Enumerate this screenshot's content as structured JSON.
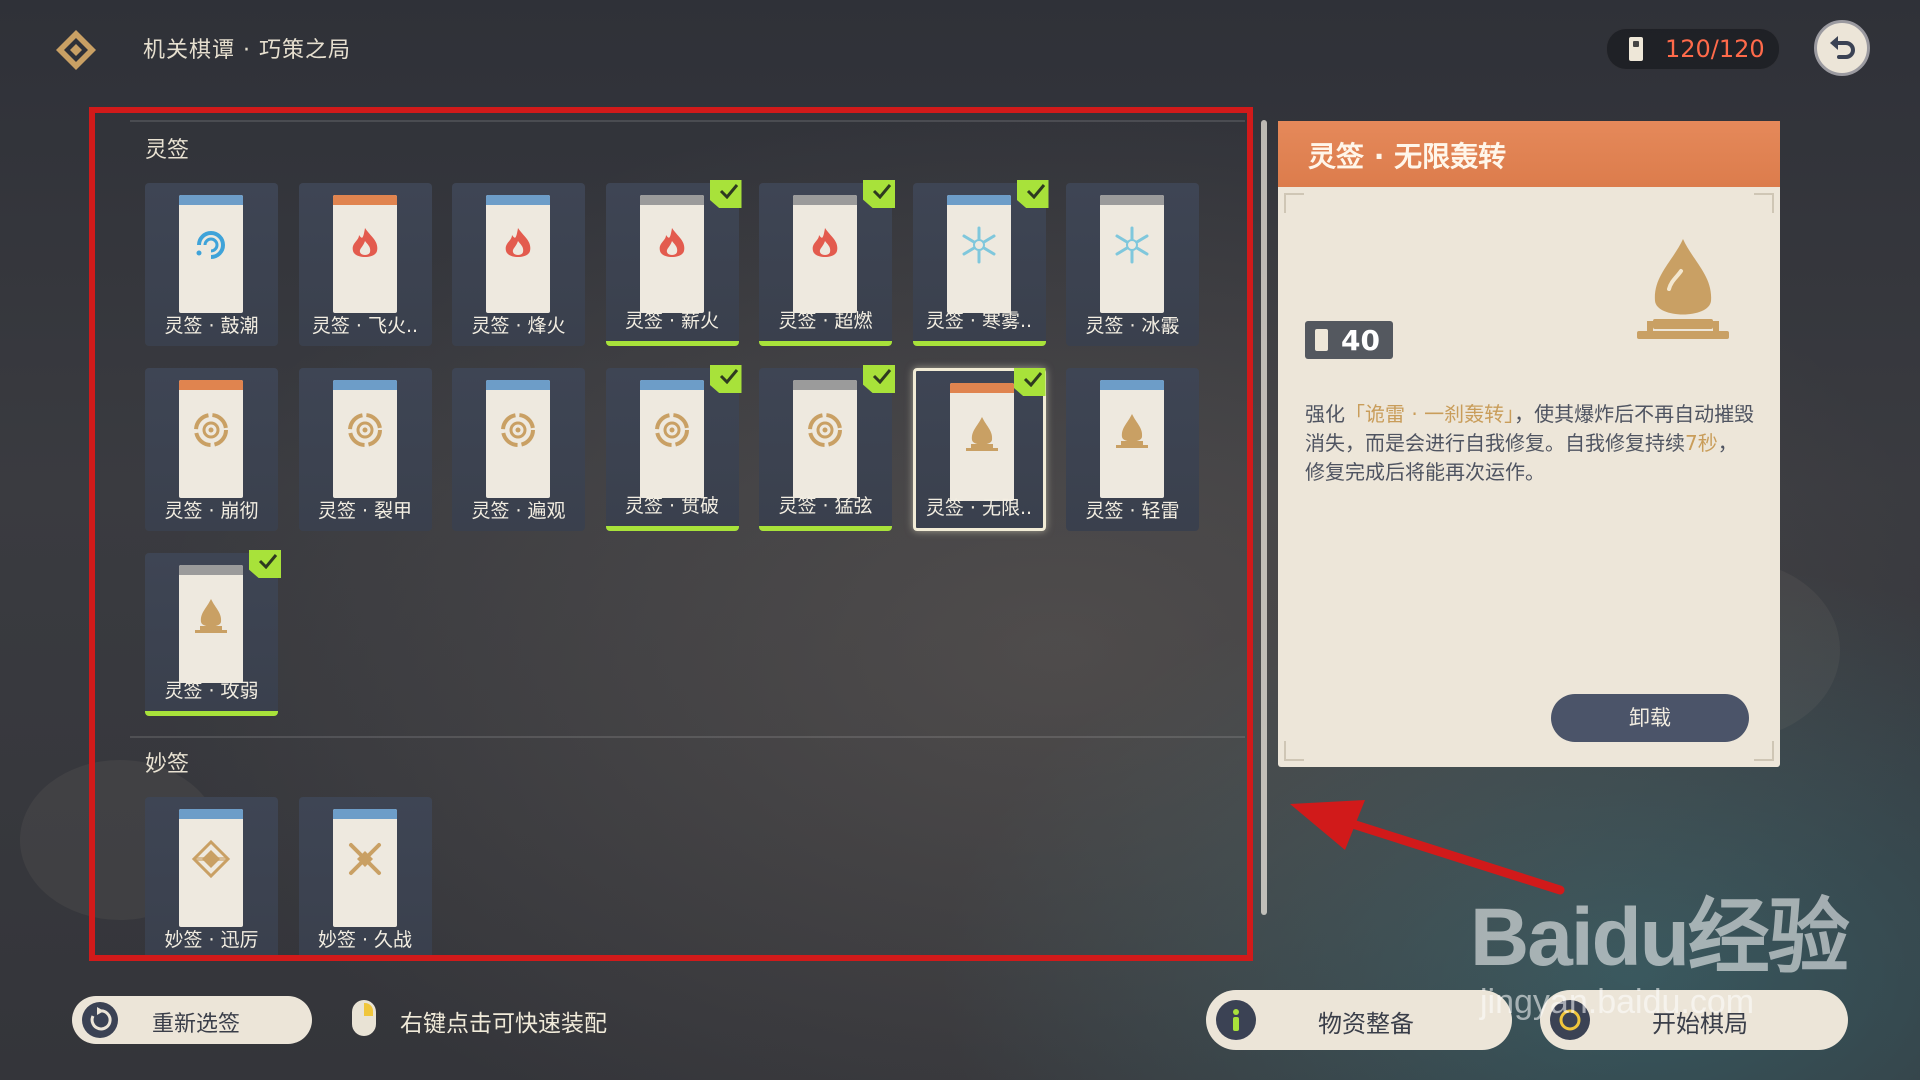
{
  "header": {
    "title": "机关棋谭 · 巧策之局",
    "currency": "120/120"
  },
  "sections": {
    "lingqian_title": "灵签",
    "miaoqian_title": "妙签"
  },
  "lingqian_cards": [
    {
      "name": "灵签 · 鼓潮",
      "cap": "blue",
      "icon": "hydro-icon",
      "equipped": false,
      "selected": false
    },
    {
      "name": "灵签 · 飞火..",
      "cap": "orange",
      "icon": "pyro-icon",
      "equipped": false,
      "selected": false
    },
    {
      "name": "灵签 · 烽火",
      "cap": "blue",
      "icon": "pyro-icon",
      "equipped": false,
      "selected": false
    },
    {
      "name": "灵签 · 薪火",
      "cap": "gray",
      "icon": "pyro-icon",
      "equipped": true,
      "selected": false
    },
    {
      "name": "灵签 · 超燃",
      "cap": "gray",
      "icon": "pyro-icon",
      "equipped": true,
      "selected": false
    },
    {
      "name": "灵签 · 寒雾..",
      "cap": "blue",
      "icon": "cryo-icon",
      "equipped": true,
      "selected": false
    },
    {
      "name": "灵签 · 冰霰",
      "cap": "gray",
      "icon": "cryo-icon",
      "equipped": false,
      "selected": false
    },
    {
      "name": "灵签 · 崩彻",
      "cap": "orange",
      "icon": "gear-target-icon",
      "equipped": false,
      "selected": false
    },
    {
      "name": "灵签 · 裂甲",
      "cap": "blue",
      "icon": "gear-target-icon",
      "equipped": false,
      "selected": false
    },
    {
      "name": "灵签 · 遍观",
      "cap": "blue",
      "icon": "gear-target-icon",
      "equipped": false,
      "selected": false
    },
    {
      "name": "灵签 · 贯破",
      "cap": "blue",
      "icon": "gear-target-icon",
      "equipped": true,
      "selected": false
    },
    {
      "name": "灵签 · 猛弦",
      "cap": "gray",
      "icon": "gear-target-icon",
      "equipped": true,
      "selected": false
    },
    {
      "name": "灵签 · 无限..",
      "cap": "orange",
      "icon": "bomb-icon",
      "equipped": true,
      "selected": true
    },
    {
      "name": "灵签 · 轻雷",
      "cap": "blue",
      "icon": "bomb-icon",
      "equipped": false,
      "selected": false
    },
    {
      "name": "灵签 · 攻弱",
      "cap": "gray",
      "icon": "bomb-icon",
      "equipped": true,
      "selected": false
    }
  ],
  "miaoqian_cards": [
    {
      "name": "妙签 · 迅厉",
      "cap": "blue",
      "icon": "diamond-emblem-icon",
      "equipped": false,
      "selected": false
    },
    {
      "name": "妙签 · 久战",
      "cap": "blue",
      "icon": "crossed-swords-icon",
      "equipped": false,
      "selected": false
    }
  ],
  "detail": {
    "title": "灵签 · 无限轰转",
    "cost": "40",
    "desc_pre": "强化",
    "desc_highlight": "「诡雷 · 一刹轰转」",
    "desc_mid": "，使其爆炸后不再自动摧毁消失，而是会进行自我修复。自我修复持续",
    "desc_num": "7秒",
    "desc_post": "，修复完成后将能再次运作。",
    "unload_label": "卸载"
  },
  "footer": {
    "reselect_label": "重新选签",
    "hint": "右键点击可快速装配",
    "supply_label": "物资整备",
    "start_label": "开始棋局"
  },
  "watermark": {
    "line1": "Baidu经验",
    "line2": "jingyan.baidu.com"
  },
  "colors": {
    "equipped": "#a8e23a",
    "cap_blue": "#6d9dc8",
    "cap_orange": "#e0844f",
    "cap_gray": "#9b9b9b",
    "pyro": "#e35b4e",
    "hydro": "#3fa3d9",
    "cryo": "#7fc7dc",
    "gold": "#c9a064",
    "annotation_red": "#d11a1a"
  }
}
